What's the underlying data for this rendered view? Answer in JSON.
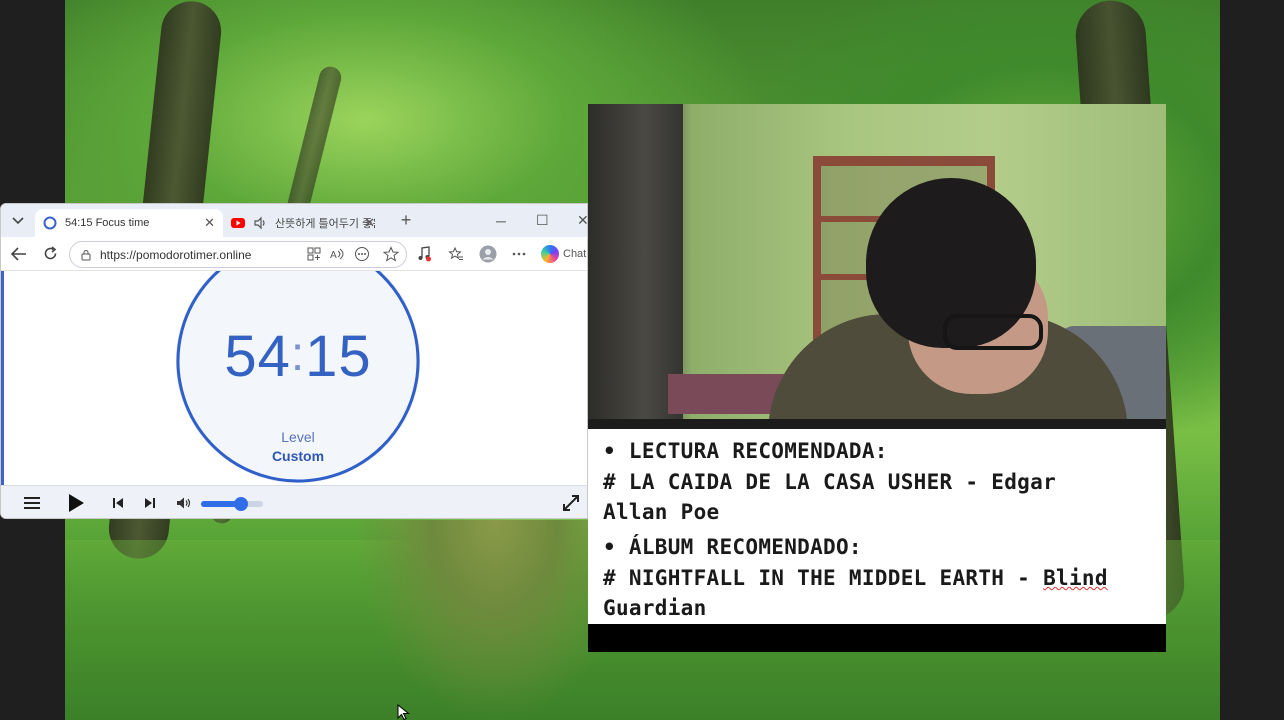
{
  "browser": {
    "tabs": [
      {
        "label": "54:15 Focus time",
        "active": true,
        "favicon": "pomodoro-circle-icon"
      },
      {
        "label": "산뜻하게 틀어두기 좋은",
        "active": false,
        "favicon": "youtube-icon",
        "audio": "speaker-icon"
      }
    ],
    "new_tab_label": "+",
    "address": {
      "url": "https://pomodorotimer.online"
    },
    "copilot_label": "Chat",
    "controls": {
      "minimize": "─",
      "maximize": "☐",
      "close": "✕"
    }
  },
  "timer": {
    "minutes": "54",
    "colon": ":",
    "seconds": "15",
    "level_label": "Level",
    "level_value": "Custom",
    "progress_fraction": 0.9
  },
  "player": {
    "volume_fraction": 0.65
  },
  "notes": {
    "line1": "• LECTURA RECOMENDADA:",
    "line2": "# LA CAIDA DE LA CASA USHER - Edgar",
    "line3": "Allan Poe",
    "line4": "• ÁLBUM RECOMENDADO:",
    "line5a": "# NIGHTFALL IN THE MIDDEL EARTH - ",
    "line5b": "Blind",
    "line6": "Guardian"
  },
  "colors": {
    "timer_blue": "#3462c2",
    "accent_blue": "#2f6ee6",
    "youtube_red": "#ff0000"
  }
}
